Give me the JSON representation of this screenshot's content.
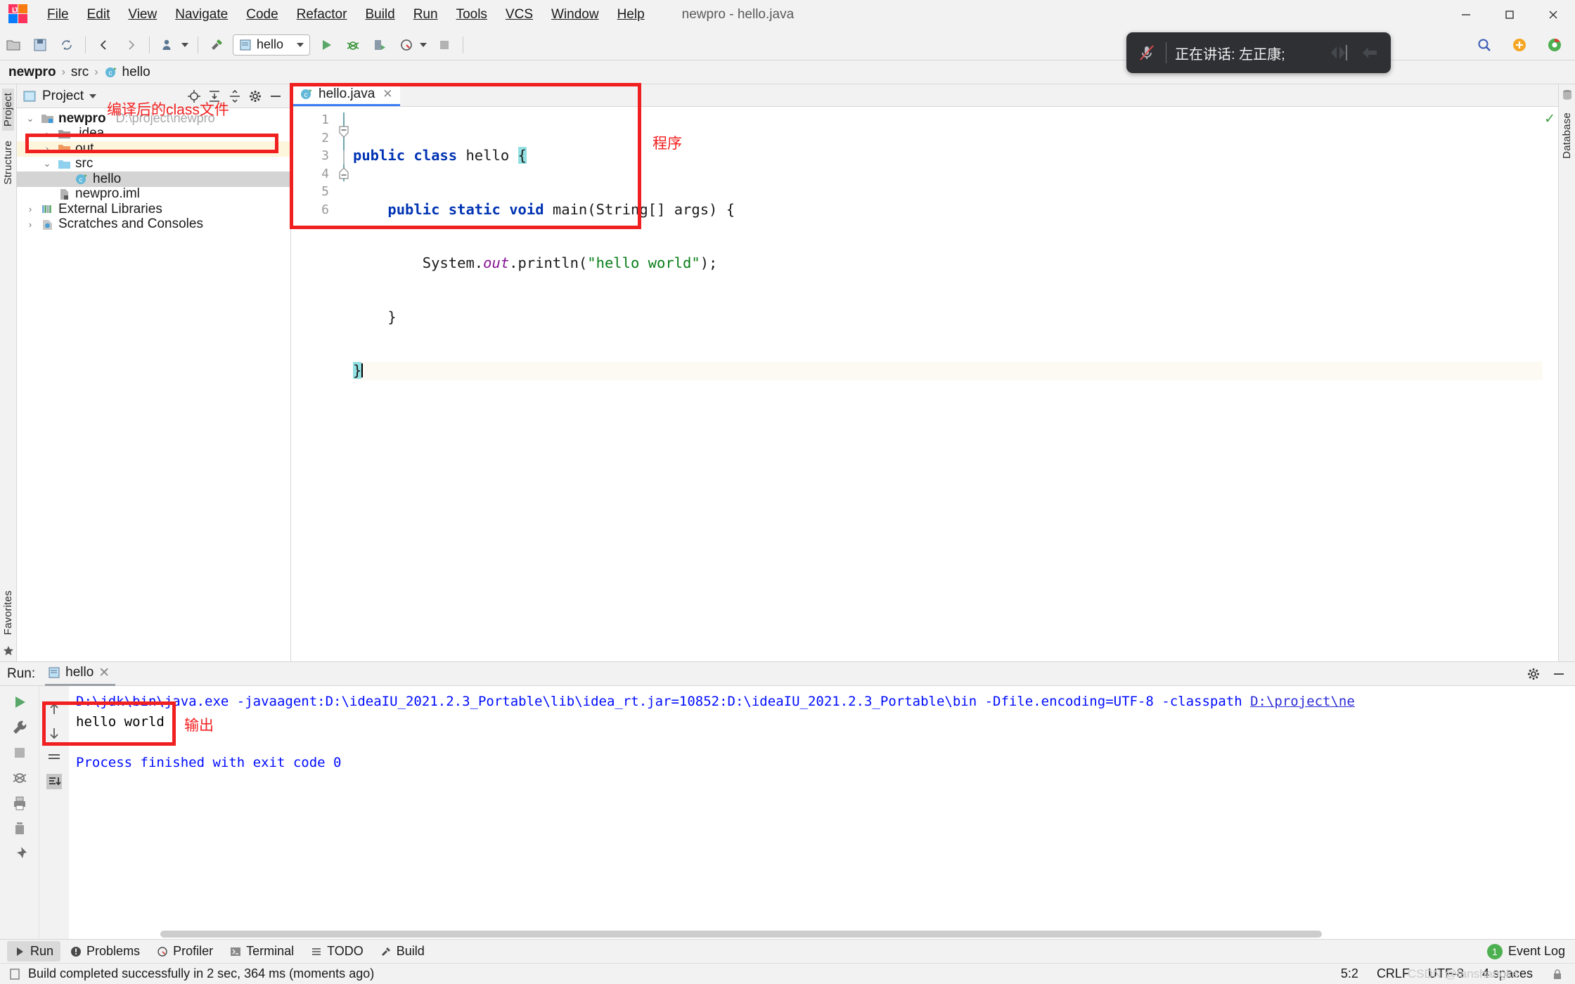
{
  "window": {
    "title": "newpro - hello.java",
    "app_icon": "intellij-idea-logo",
    "minimize": "─",
    "maximize": "☐",
    "close": "✕"
  },
  "menu": [
    {
      "label": "File"
    },
    {
      "label": "Edit"
    },
    {
      "label": "View"
    },
    {
      "label": "Navigate"
    },
    {
      "label": "Code"
    },
    {
      "label": "Refactor"
    },
    {
      "label": "Build"
    },
    {
      "label": "Run"
    },
    {
      "label": "Tools"
    },
    {
      "label": "VCS"
    },
    {
      "label": "Window"
    },
    {
      "label": "Help"
    }
  ],
  "toolbar": {
    "run_configuration": "hello",
    "buttons": [
      "open-icon",
      "save-all-icon",
      "sync-icon",
      "back-icon",
      "forward-icon",
      "profile-icon",
      "build-hammer-icon",
      "run-icon",
      "debug-icon",
      "run-coverage-icon",
      "profiler-icon",
      "stop-icon",
      "search-icon",
      "plus-icon",
      "browser-icon"
    ]
  },
  "meeting_overlay": {
    "mic_icon": "mic-muted-icon",
    "speaking_text": "正在讲话: 左正康;",
    "share_icon": "screen-share-icon",
    "leave_icon": "leave-arrow-icon"
  },
  "breadcrumb": [
    {
      "label": "newpro",
      "bold": true,
      "icon": ""
    },
    {
      "label": "src",
      "bold": false,
      "icon": ""
    },
    {
      "label": "hello",
      "bold": false,
      "icon": "java-class-icon"
    }
  ],
  "left_rail": {
    "top": [
      "Project",
      "Structure"
    ],
    "bottom": [
      "Favorites"
    ]
  },
  "right_rail": {
    "items": [
      "Database"
    ]
  },
  "project_panel": {
    "title": "Project",
    "actions": [
      "locate-icon",
      "expand-all-icon",
      "collapse-all-icon",
      "settings-gear-icon",
      "hide-icon"
    ],
    "tree": [
      {
        "label": "newpro",
        "path": "D:\\project\\newpro",
        "depth": 0,
        "twisty": "⌄",
        "icon": "project-folder-icon",
        "bold": true,
        "state": "normal"
      },
      {
        "label": ".idea",
        "path": "",
        "depth": 1,
        "twisty": "›",
        "icon": "folder-grey-icon",
        "bold": false,
        "state": "normal"
      },
      {
        "label": "out",
        "path": "",
        "depth": 1,
        "twisty": "›",
        "icon": "folder-orange-icon",
        "bold": false,
        "state": "highlight"
      },
      {
        "label": "src",
        "path": "",
        "depth": 1,
        "twisty": "⌄",
        "icon": "folder-blue-icon",
        "bold": false,
        "state": "normal"
      },
      {
        "label": "hello",
        "path": "",
        "depth": 2,
        "twisty": "",
        "icon": "java-class-icon",
        "bold": false,
        "state": "selected"
      },
      {
        "label": "newpro.iml",
        "path": "",
        "depth": 1,
        "twisty": "",
        "icon": "iml-file-icon",
        "bold": false,
        "state": "normal"
      },
      {
        "label": "External Libraries",
        "path": "",
        "depth": 0,
        "twisty": "›",
        "icon": "libraries-icon",
        "bold": false,
        "state": "normal"
      },
      {
        "label": "Scratches and Consoles",
        "path": "",
        "depth": 0,
        "twisty": "›",
        "icon": "scratches-icon",
        "bold": false,
        "state": "normal"
      }
    ]
  },
  "annotations": {
    "class_files": "编译后的class文件",
    "program": "程序",
    "output": "输出",
    "box_color": "#f02020"
  },
  "editor": {
    "tab": {
      "label": "hello.java",
      "icon": "java-class-icon",
      "close": "✕"
    },
    "inspection_status": "ok-check-icon",
    "lines": [
      {
        "n": "1",
        "run_marker": true,
        "fold": "",
        "current": false
      },
      {
        "n": "2",
        "run_marker": true,
        "fold": "minus",
        "current": false
      },
      {
        "n": "3",
        "run_marker": false,
        "fold": "bar",
        "current": false
      },
      {
        "n": "4",
        "run_marker": false,
        "fold": "end",
        "current": false
      },
      {
        "n": "5",
        "run_marker": false,
        "fold": "",
        "current": true
      },
      {
        "n": "6",
        "run_marker": false,
        "fold": "",
        "current": false
      }
    ],
    "code_text": [
      "public class hello {",
      "    public static void main(String[] args) {",
      "        System.out.println(\"hello world\");",
      "    }",
      "}",
      ""
    ]
  },
  "run_window": {
    "label": "Run:",
    "tab": "hello",
    "tab_close": "✕",
    "header_actions": [
      "settings-gear-icon",
      "hide-window-icon"
    ],
    "side_actions": [
      "rerun-icon",
      "wrench-icon",
      "stop-icon",
      "trace-icon",
      "print-icon",
      "trash-icon",
      "pin-icon"
    ],
    "side_actions2": [
      "scroll-up-icon",
      "scroll-down-icon",
      "soft-wrap-icon",
      "scroll-to-end-icon"
    ],
    "console": {
      "command_prefix": "D:\\jdk\\bin\\java.exe -javaagent:D:\\ideaIU_2021.2.3_Portable\\lib\\idea_rt.jar=10852:D:\\ideaIU_2021.2.3_Portable\\bin -Dfile.encoding=UTF-8 -classpath ",
      "command_link": "D:\\project\\ne",
      "output": "hello world",
      "exit_line": "Process finished with exit code 0"
    }
  },
  "bottom_tabs": [
    {
      "label": "Run",
      "icon": "run-icon",
      "selected": true
    },
    {
      "label": "Problems",
      "icon": "problems-icon",
      "selected": false
    },
    {
      "label": "Profiler",
      "icon": "profiler-icon",
      "selected": false
    },
    {
      "label": "Terminal",
      "icon": "terminal-icon",
      "selected": false
    },
    {
      "label": "TODO",
      "icon": "todo-icon",
      "selected": false
    },
    {
      "label": "Build",
      "icon": "build-hammer-icon",
      "selected": false
    }
  ],
  "event_log": {
    "count": "1",
    "label": "Event Log"
  },
  "status_bar": {
    "message": "Build completed successfully in 2 sec, 364 ms (moments ago)",
    "caret": "5:2",
    "line_separator": "CRLF",
    "encoding": "UTF-8",
    "indent": "4 spaces",
    "lock_icon": "lock-icon",
    "watermark": "CSDN @fanshangke"
  }
}
